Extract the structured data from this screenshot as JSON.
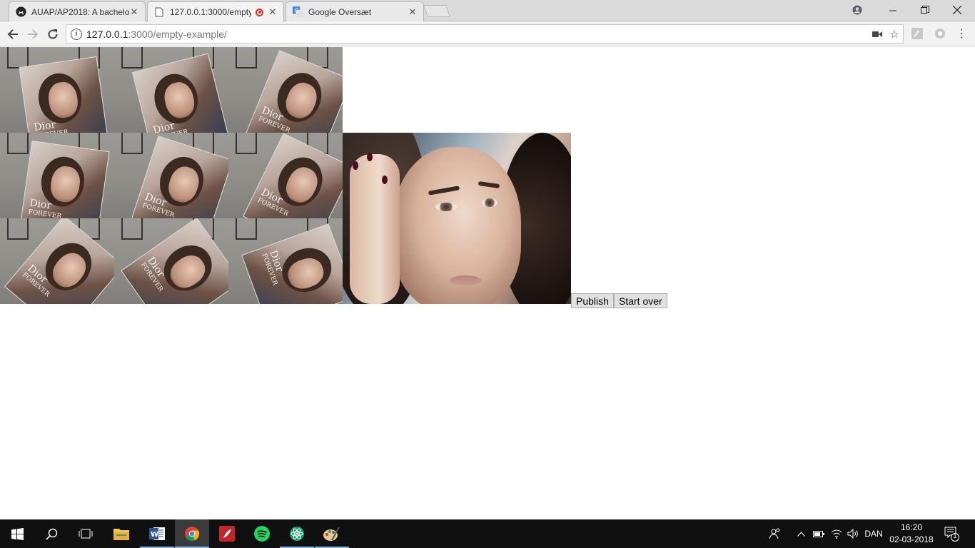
{
  "browser": {
    "tabs": [
      {
        "title": "AUAP/AP2018: A bachelo",
        "favicon": "github-icon",
        "active": false
      },
      {
        "title": "127.0.0.1:3000/empty",
        "favicon": "page-icon",
        "active": true,
        "recording": true
      },
      {
        "title": "Google Oversæt",
        "favicon": "google-translate-icon",
        "active": false
      }
    ],
    "address": {
      "host": "127.0.0.1",
      "path": ":3000/empty-example/"
    }
  },
  "page": {
    "thumbnails_count": 9,
    "buttons": {
      "publish": "Publish",
      "start_over": "Start over"
    },
    "magazine_text": "Dior",
    "magazine_subtext": "FOREVER"
  },
  "taskbar": {
    "apps": [
      "windows-start",
      "search",
      "task-view",
      "file-explorer",
      "word",
      "chrome",
      "red-app",
      "spotify",
      "atom",
      "paint"
    ],
    "language": "DAN",
    "time": "16:20",
    "date": "02-03-2018",
    "notifications": "1"
  },
  "colors": {
    "taskbar": "#101010",
    "chrome_frame": "#dadada",
    "recording": "#d93025",
    "running_indicator": "#76b9ed"
  }
}
